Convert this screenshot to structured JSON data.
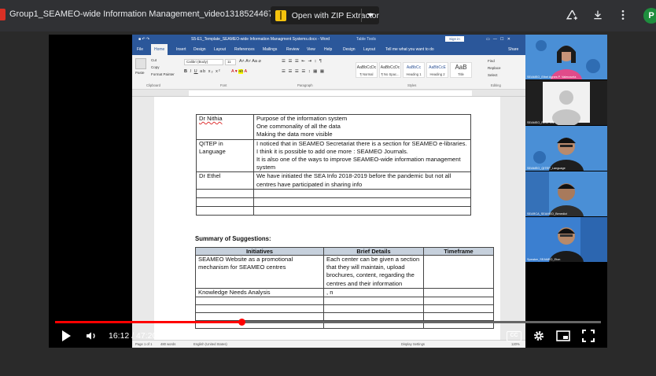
{
  "browser": {
    "file_name": "Group1_SEAMEO-wide Information Management_video1318524467.mp4",
    "open_with_label": "Open with ZIP Extractor",
    "avatar_letter": "P",
    "icons": [
      "add-to-drive-icon",
      "download-icon",
      "more-vert-icon"
    ]
  },
  "word": {
    "title": "S5-E1_Template_SEAMEO-wide Information Managment Systems.docx - Word",
    "table_tools": "Table Tools",
    "sign_in": "Sign in",
    "menu": [
      "File",
      "Home",
      "Insert",
      "Design",
      "Layout",
      "References",
      "Mailings",
      "Review",
      "View",
      "Help",
      "Design",
      "Layout",
      "Tell me what you want to do",
      "Share"
    ],
    "ribbon": {
      "paste": "Paste",
      "cut": "Cut",
      "copy": "Copy",
      "format_painter": "Format Painter",
      "font_name": "Calibri (Body)",
      "font_size": "11",
      "clipboard": "Clipboard",
      "font": "Font",
      "paragraph": "Paragraph",
      "styles": "Styles",
      "editing": "Editing",
      "style_items": [
        {
          "preview": "AaBbCcDc",
          "name": "¶ Normal"
        },
        {
          "preview": "AaBbCcDc",
          "name": "¶ No Spac..."
        },
        {
          "preview": "AaBbCc",
          "name": "Heading 1"
        },
        {
          "preview": "AaBbCcE",
          "name": "Heading 2"
        },
        {
          "preview": "AaB",
          "name": "Title"
        }
      ],
      "find": "Find",
      "replace": "Replace",
      "select": "Select"
    },
    "doc": {
      "table1": [
        {
          "name": "Dr Nithia",
          "lines": [
            "Purpose of the information system",
            "One commonality of all the data",
            "Making the data more visible"
          ]
        },
        {
          "name": "QITEP in Language",
          "lines": [
            "I noticed that in SEAMEO Secretariat there is a section for SEAMEO e-libraries. I think it is possible to add one more : SEAMEO Journals.",
            "It is also one of the ways to improve SEAMEO-wide information management system"
          ]
        },
        {
          "name": "Dr Ethel",
          "lines": [
            "We have initiated the SEA Info 2018-2019 before the pandemic but not all centres have participated in sharing info"
          ]
        }
      ],
      "summary_heading": "Summary of Suggestions:",
      "table2_headers": [
        "Initiatives",
        "Brief Details",
        "Timeframe"
      ],
      "table2_rows": [
        {
          "initiative": "SEAMEO Website as a promotional mechanism for SEAMEO centres",
          "details": "Each center can be given a section that they will maintain, upload brochures, content, regarding the centres and their information",
          "timeframe": ""
        },
        {
          "initiative": "Knowledge Needs Analysis",
          "details": ", n",
          "timeframe": ""
        }
      ]
    },
    "status": {
      "page": "Page 1 of 1",
      "words": "480 words",
      "language": "English (United States)",
      "display": "Display Settings",
      "zoom": "120%"
    }
  },
  "participants": [
    {
      "name": "SEAMEO_Ethel Agnes P. Valenzuela"
    },
    {
      "name": "SEAMEO_RECFON"
    },
    {
      "name": "SEAMEO_QITEP_Language"
    },
    {
      "name": "SEARCA_SEAMEO_Benedict"
    },
    {
      "name": "Speaker_SEAMEO_Eton"
    }
  ],
  "player": {
    "time_display": "16:12 / 47:20",
    "progress_fraction": 0.342,
    "cc_label": "CC"
  }
}
